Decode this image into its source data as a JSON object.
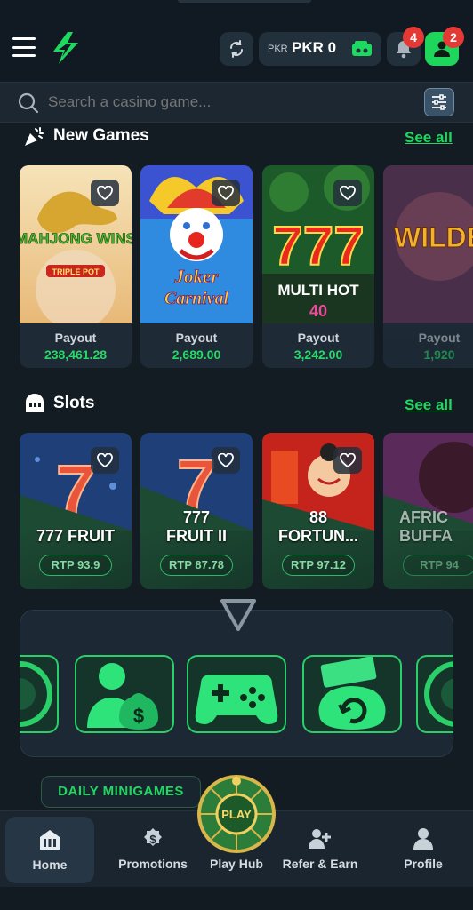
{
  "header": {
    "currency": "PKR",
    "balance": "PKR 0",
    "notifications_count": "4",
    "profile_count": "2",
    "accent_color": "#1ed95f",
    "badge_color": "#e53935"
  },
  "search": {
    "placeholder": "Search a casino game..."
  },
  "new_games": {
    "title": "New Games",
    "see_all": "See all",
    "cards": [
      {
        "art_text": "MAHJONG WINS",
        "art_sub": "TRIPLE POT",
        "payout_label": "Payout",
        "payout_value": "238,461.28"
      },
      {
        "art_text": "Joker",
        "art_sub": "Carnival",
        "payout_label": "Payout",
        "payout_value": "2,689.00"
      },
      {
        "art_text": "777",
        "art_sub": "MULTI HOT 40",
        "payout_label": "Payout",
        "payout_value": "3,242.00"
      },
      {
        "art_text": "WILDE",
        "art_sub": "",
        "payout_label": "Payout",
        "payout_value": "1,920"
      }
    ]
  },
  "slots": {
    "title": "Slots",
    "see_all": "See all",
    "cards": [
      {
        "name": "777 FRUIT",
        "rtp": "RTP 93.9"
      },
      {
        "name": "777 FRUIT II",
        "rtp": "RTP 87.78"
      },
      {
        "name": "88 FORTUN...",
        "rtp": "RTP 97.12"
      },
      {
        "name": "AFRIC BUFFA",
        "rtp": "RTP 94"
      }
    ]
  },
  "minigames": {
    "daily_label": "DAILY MINIGAMES",
    "play_label": "PLAY",
    "items": [
      "roulette-wheel",
      "money-person",
      "gamepad",
      "cash-bag",
      "roulette-wheel"
    ]
  },
  "bottom_nav": {
    "items": [
      {
        "label": "Home",
        "icon": "home-icon"
      },
      {
        "label": "Promotions",
        "icon": "dollar-badge-icon"
      },
      {
        "label": "Play Hub",
        "icon": "play-wheel-icon"
      },
      {
        "label": "Refer & Earn",
        "icon": "add-users-icon"
      },
      {
        "label": "Profile",
        "icon": "user-icon"
      }
    ]
  }
}
